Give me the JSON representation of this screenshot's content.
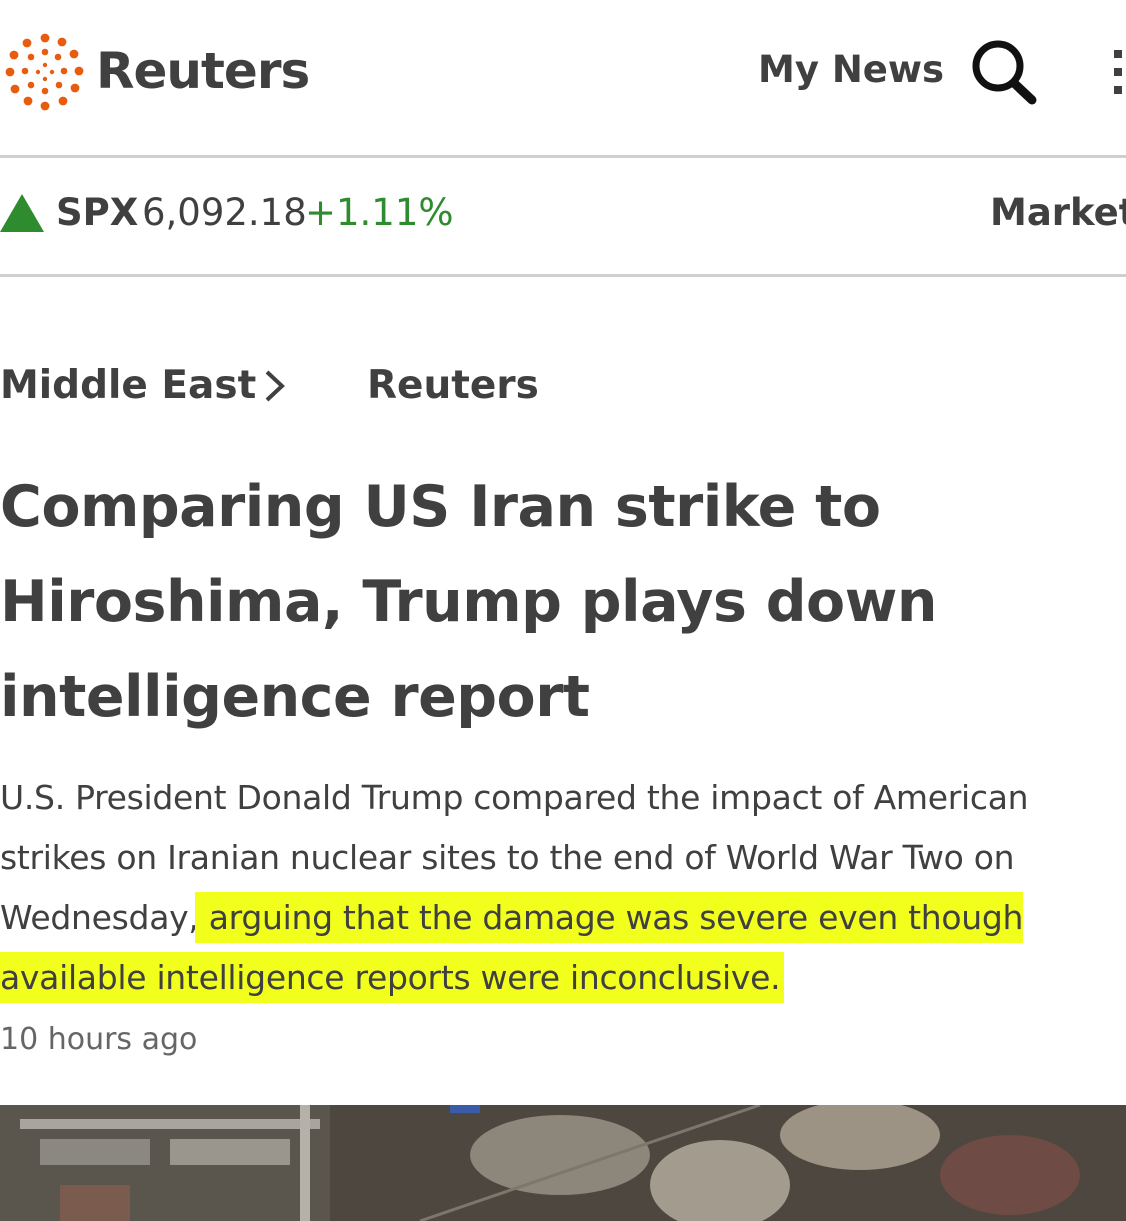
{
  "header": {
    "brand": "Reuters",
    "my_news_label": "My News",
    "search_icon": "search-icon",
    "menu_icon": "kebab-menu-icon",
    "logo_color": "#e85c0d"
  },
  "ticker": {
    "symbol": "SPX",
    "price": "6,092.18",
    "change": "+1.11%",
    "direction_icon": "up-triangle-icon",
    "up_color": "#2e8b2e",
    "market_label": "Market"
  },
  "article": {
    "section": "Middle East",
    "section_icon": "chevron-right-icon",
    "source": "Reuters",
    "headline": "Comparing US Iran strike to Hiroshima, Trump plays down intelligence report",
    "summary_plain": "U.S. President Donald Trump compared the impact of American strikes on Iranian nuclear sites to the end of World War Two on Wednesday,",
    "summary_highlighted": " arguing that the damage was severe even though available intelligence reports were inconclusive.",
    "highlight_color": "#f2ff1c",
    "timestamp": "10 hours ago"
  }
}
